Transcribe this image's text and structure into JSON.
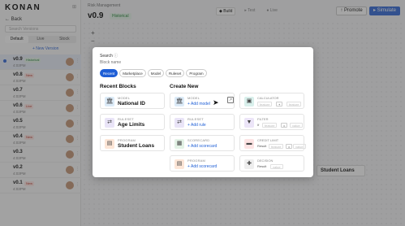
{
  "app": {
    "brand": "KONAN",
    "back_label": "← Back",
    "search_placeholder": "Search Versions",
    "tabs": [
      "Default",
      "Live",
      "Stock"
    ],
    "new_version": "+ New Version",
    "breadcrumb": "Risk Management",
    "version_title": "v0.9",
    "version_badge": "Historical",
    "modes": [
      "Build",
      "Test",
      "Live"
    ],
    "promote_label": "Promote",
    "simulate_label": "Simulate",
    "canvas_node": "Student Loans"
  },
  "versions": [
    {
      "name": "v0.9",
      "badge": "Historical",
      "badge_type": "historical",
      "time": "4:03PM"
    },
    {
      "name": "v0.8",
      "badge": "New",
      "badge_type": "live",
      "time": "4:03PM"
    },
    {
      "name": "v0.7",
      "badge": "",
      "badge_type": "",
      "time": "4:03PM"
    },
    {
      "name": "v0.6",
      "badge": "Live",
      "badge_type": "live",
      "time": "4:03PM"
    },
    {
      "name": "v0.5",
      "badge": "",
      "badge_type": "",
      "time": "4:03PM"
    },
    {
      "name": "v0.4",
      "badge": "New",
      "badge_type": "live",
      "time": "4:03PM"
    },
    {
      "name": "v0.3",
      "badge": "",
      "badge_type": "",
      "time": "4:03PM"
    },
    {
      "name": "v0.2",
      "badge": "",
      "badge_type": "",
      "time": "4:03PM"
    },
    {
      "name": "v0.1",
      "badge": "New",
      "badge_type": "live",
      "time": "4:03PM"
    }
  ],
  "modal": {
    "search_label": "Search",
    "search_info": "ⓘ",
    "search_placeholder": "Block name",
    "filters": [
      "Recent",
      "Marketplace",
      "Model",
      "Ruleset",
      "Program"
    ],
    "recent_title": "Recent Blocks",
    "create_title": "Create New",
    "recent": [
      {
        "kind": "MODEL",
        "name": "National ID",
        "icon": "bank-icon",
        "glyph": "🏛"
      },
      {
        "kind": "RULESET",
        "name": "Age Limits",
        "icon": "ruleset-icon",
        "glyph": "⇄"
      },
      {
        "kind": "PROGRAM",
        "name": "Student Loans",
        "icon": "program-icon",
        "glyph": "▤"
      }
    ],
    "create": [
      {
        "kind": "MODEL",
        "add": "+ Add model",
        "icon": "bank-icon",
        "glyph": "🏛"
      },
      {
        "kind": "RULESET",
        "add": "+ Add rule",
        "icon": "ruleset-icon",
        "glyph": "⇄"
      },
      {
        "kind": "SCORECARD",
        "add": "+ Add scorecard",
        "icon": "scorecard-icon",
        "glyph": "▦"
      },
      {
        "kind": "PROGRAM",
        "add": "+ Add scorecard",
        "icon": "program-icon",
        "glyph": "▤"
      }
    ],
    "calculator": {
      "kind": "CALCULATOR",
      "f1": "feature",
      "op": "+",
      "f2": "feature",
      "icon": "calculator-icon",
      "glyph": "▣"
    },
    "filter": {
      "kind": "FILTER",
      "if": "If",
      "f1": "feature",
      "op": "=",
      "val": "value",
      "icon": "filter-icon",
      "glyph": "▼"
    },
    "credit": {
      "kind": "CREDIT LIMIT",
      "result": "Result",
      "f1": "feature",
      "op": "=",
      "val": "value",
      "icon": "credit-icon",
      "glyph": "▬"
    },
    "decision": {
      "kind": "DECISION",
      "result": "Result",
      "val": "value",
      "icon": "decision-icon",
      "glyph": "✚"
    }
  }
}
